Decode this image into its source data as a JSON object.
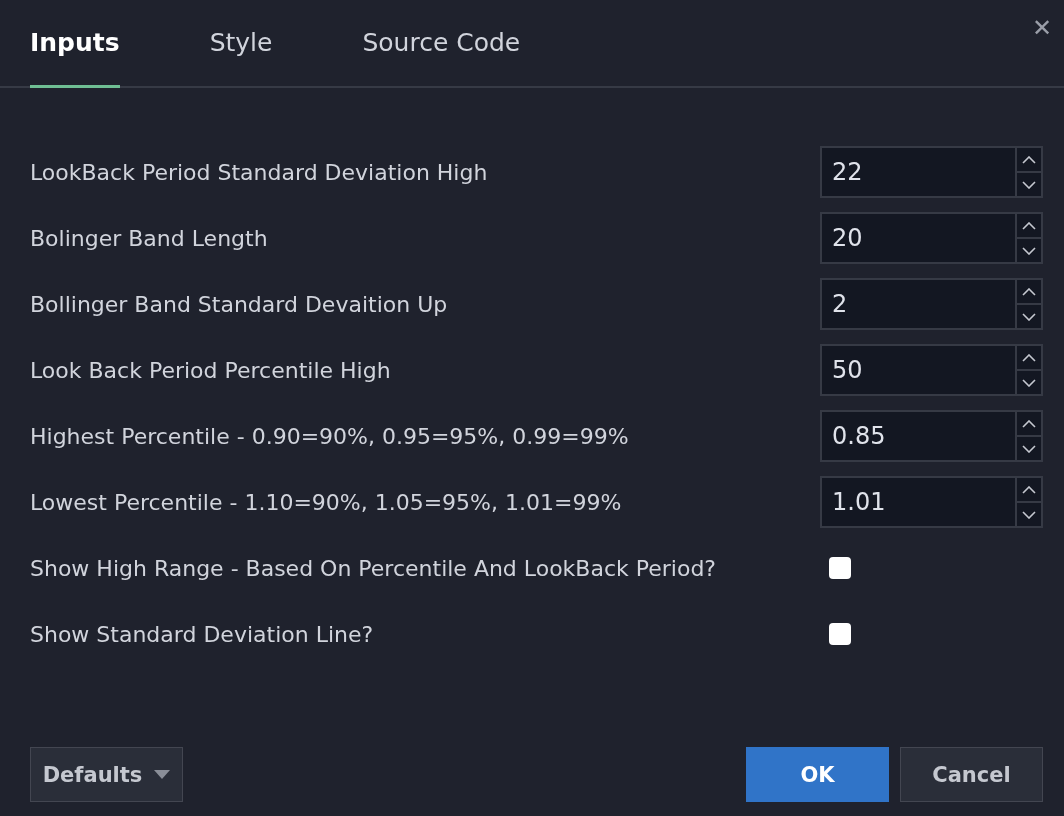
{
  "tabs": [
    {
      "label": "Inputs",
      "selected": true
    },
    {
      "label": "Style",
      "selected": false
    },
    {
      "label": "Source Code",
      "selected": false
    }
  ],
  "close": "✕",
  "inputs": [
    {
      "kind": "number",
      "label": "LookBack Period Standard Deviation High",
      "value": "22"
    },
    {
      "kind": "number",
      "label": "Bolinger Band Length",
      "value": "20"
    },
    {
      "kind": "number",
      "label": "Bollinger Band Standard Devaition Up",
      "value": "2"
    },
    {
      "kind": "number",
      "label": "Look Back Period Percentile High",
      "value": "50"
    },
    {
      "kind": "number",
      "label": "Highest Percentile - 0.90=90%, 0.95=95%, 0.99=99%",
      "value": "0.85"
    },
    {
      "kind": "number",
      "label": "Lowest Percentile - 1.10=90%, 1.05=95%, 1.01=99%",
      "value": "1.01"
    },
    {
      "kind": "checkbox",
      "label": "Show High Range - Based On Percentile And LookBack Period?",
      "checked": false
    },
    {
      "kind": "checkbox",
      "label": "Show Standard Deviation Line?",
      "checked": false
    }
  ],
  "footer": {
    "defaults": "Defaults",
    "ok": "OK",
    "cancel": "Cancel"
  }
}
